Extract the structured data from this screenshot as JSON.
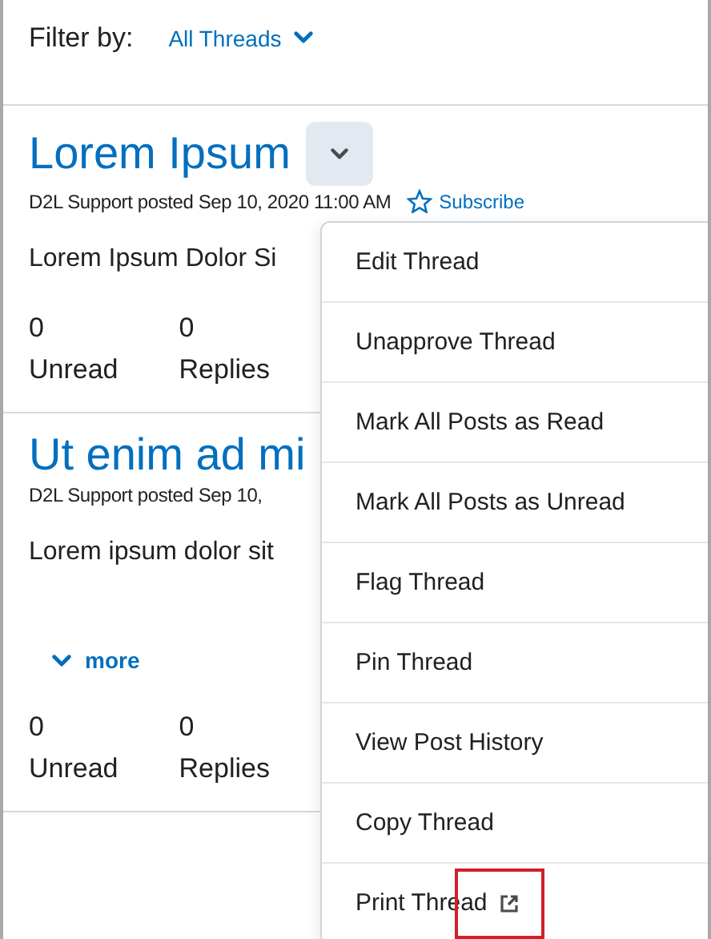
{
  "filter": {
    "label": "Filter by:",
    "value": "All Threads"
  },
  "threads": [
    {
      "title": "Lorem Ipsum",
      "has_menu_button": true,
      "meta": "D2L Support posted Sep 10, 2020 11:00 AM",
      "subscribe": "Subscribe",
      "body": "Lorem Ipsum Dolor Si",
      "stats": [
        {
          "count": "0",
          "label": "Unread"
        },
        {
          "count": "0",
          "label": "Replies"
        }
      ]
    },
    {
      "title": "Ut enim ad mi",
      "meta": "D2L Support posted Sep 10,",
      "body": "Lorem ipsum dolor sit",
      "more": "more",
      "stats": [
        {
          "count": "0",
          "label": "Unread"
        },
        {
          "count": "0",
          "label": "Replies"
        }
      ]
    }
  ],
  "menu": {
    "items": [
      {
        "label": "Edit Thread",
        "external": false
      },
      {
        "label": "Unapprove Thread",
        "external": false
      },
      {
        "label": "Mark All Posts as Read",
        "external": false
      },
      {
        "label": "Mark All Posts as Unread",
        "external": false
      },
      {
        "label": "Flag Thread",
        "external": false
      },
      {
        "label": "Pin Thread",
        "external": false
      },
      {
        "label": "View Post History",
        "external": false
      },
      {
        "label": "Copy Thread",
        "external": false
      },
      {
        "label": "Print Thread",
        "external": true
      }
    ]
  }
}
